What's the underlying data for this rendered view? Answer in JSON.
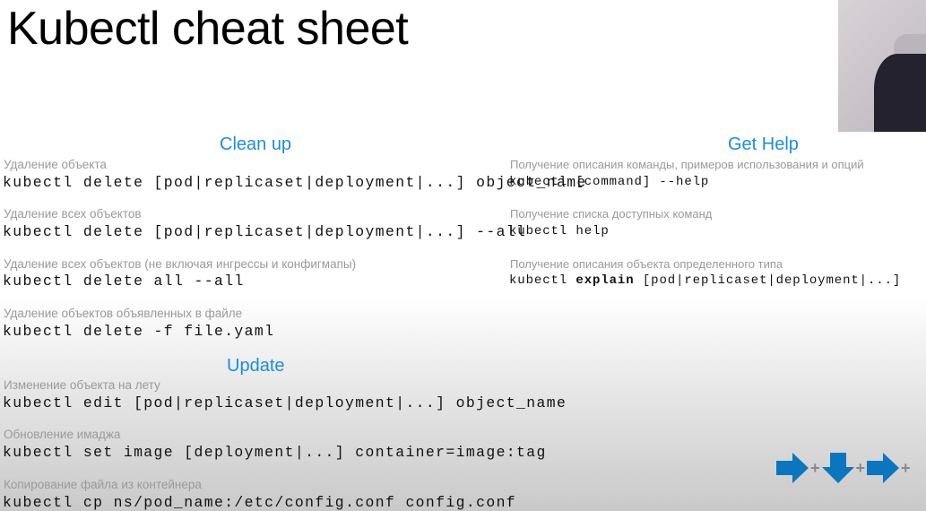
{
  "title": "Kubectl cheat sheet",
  "cleanup": {
    "heading": "Clean up",
    "items": [
      {
        "label": "Удаление объекта",
        "code": "kubectl delete [pod|replicaset|deployment|...] object_name"
      },
      {
        "label": "Удаление всех объектов",
        "code": "kubectl delete [pod|replicaset|deployment|...] --all"
      },
      {
        "label": "Удаление всех объектов (не включая ингрессы и конфигмапы)",
        "code": "kubectl delete all --all"
      },
      {
        "label": "Удаление объектов объявленных в файле",
        "code": "kubectl delete -f file.yaml"
      }
    ]
  },
  "update": {
    "heading": "Update",
    "items": [
      {
        "label": "Изменение объекта на лету",
        "code": "kubectl edit [pod|replicaset|deployment|...] object_name"
      },
      {
        "label": "Обновление имаджа",
        "code": "kubectl set image [deployment|...] container=image:tag"
      },
      {
        "label": "Копирование файла из контейнера",
        "code": "kubectl cp ns/pod_name:/etc/config.conf config.conf"
      }
    ]
  },
  "help": {
    "heading": "Get Help",
    "items": [
      {
        "label": "Получение описания команды, примеров использования и опций",
        "code": "kubectl [command] --help"
      },
      {
        "label": "Получение списка доступных команд",
        "code": "kubectl help"
      },
      {
        "label": "Получение описания объекта определенного типа",
        "code_pre": "kubectl ",
        "code_bold": "explain",
        "code_post": " [pod|replicaset|deployment|...]"
      }
    ]
  },
  "nav": {
    "plus": "+",
    "color": "#0a76be"
  }
}
